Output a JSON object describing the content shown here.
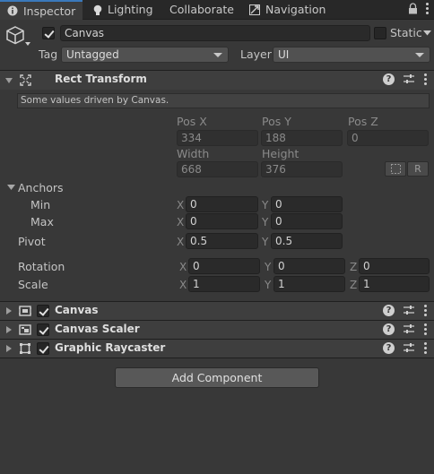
{
  "tabs": [
    {
      "label": "Inspector",
      "icon": "info-icon",
      "active": true
    },
    {
      "label": "Lighting",
      "icon": "lightbulb-icon",
      "active": false
    },
    {
      "label": "Collaborate",
      "icon": "",
      "active": false
    },
    {
      "label": "Navigation",
      "icon": "navigation-icon",
      "active": false
    }
  ],
  "header": {
    "name": "Canvas",
    "static_label": "Static",
    "tag_label": "Tag",
    "tag_value": "Untagged",
    "layer_label": "Layer",
    "layer_value": "UI"
  },
  "rect_transform": {
    "title": "Rect Transform",
    "info": "Some values driven by Canvas.",
    "pos_x_label": "Pos X",
    "pos_y_label": "Pos Y",
    "pos_z_label": "Pos Z",
    "pos_x": "334",
    "pos_y": "188",
    "pos_z": "0",
    "width_label": "Width",
    "height_label": "Height",
    "width": "668",
    "height": "376",
    "r_button": "R",
    "anchors_label": "Anchors",
    "min_label": "Min",
    "max_label": "Max",
    "min_x": "0",
    "min_y": "0",
    "max_x": "0",
    "max_y": "0",
    "pivot_label": "Pivot",
    "pivot_x": "0.5",
    "pivot_y": "0.5",
    "rotation_label": "Rotation",
    "rot_x": "0",
    "rot_y": "0",
    "rot_z": "0",
    "scale_label": "Scale",
    "scale_x": "1",
    "scale_y": "1",
    "scale_z": "1",
    "axis_x": "X",
    "axis_y": "Y",
    "axis_z": "Z"
  },
  "components": [
    {
      "title": "Canvas",
      "icon": "canvas-icon"
    },
    {
      "title": "Canvas Scaler",
      "icon": "canvas-scaler-icon"
    },
    {
      "title": "Graphic Raycaster",
      "icon": "graphic-raycaster-icon"
    }
  ],
  "add_component": "Add Component",
  "colors": {
    "background": "#383838",
    "accent": "#3a79bb"
  }
}
